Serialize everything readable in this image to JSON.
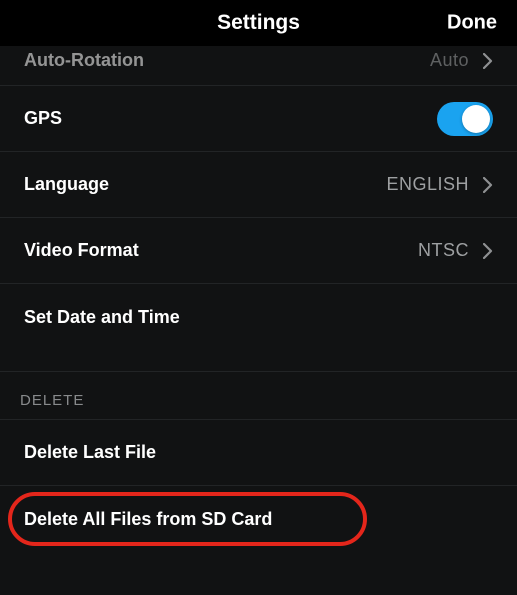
{
  "header": {
    "title": "Settings",
    "done": "Done"
  },
  "rows": {
    "auto_rotation": {
      "label": "Auto-Rotation",
      "value": "Auto"
    },
    "gps": {
      "label": "GPS",
      "on": true
    },
    "language": {
      "label": "Language",
      "value": "ENGLISH"
    },
    "video_format": {
      "label": "Video Format",
      "value": "NTSC"
    },
    "set_date_time": {
      "label": "Set Date and Time"
    }
  },
  "sections": {
    "delete": {
      "title": "DELETE",
      "items": {
        "delete_last": {
          "label": "Delete Last File"
        },
        "delete_all": {
          "label": "Delete All Files from SD Card"
        }
      }
    }
  }
}
